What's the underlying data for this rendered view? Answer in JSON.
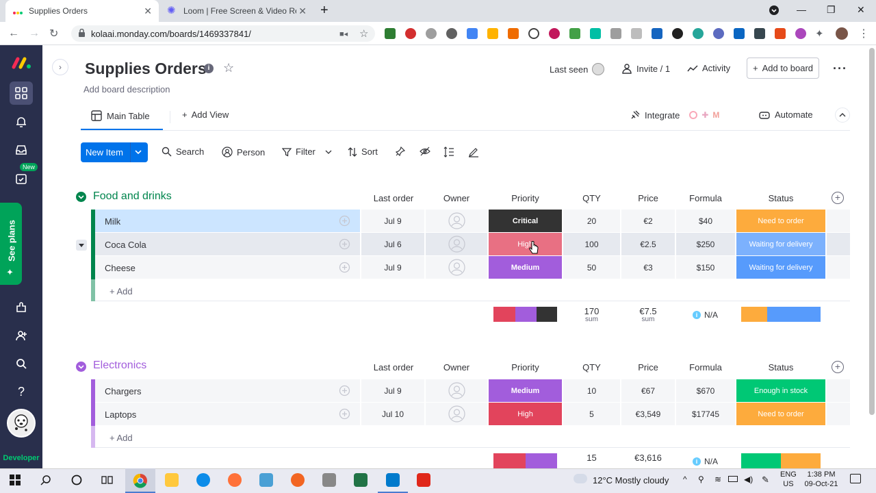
{
  "browser": {
    "tabs": [
      {
        "title": "Supplies Orders"
      },
      {
        "title": "Loom | Free Screen & Video Reco"
      }
    ],
    "url": "kolaai.monday.com/boards/1469337841/"
  },
  "rail": {
    "new_badge": "New",
    "see_plans": "See plans",
    "developer": "Developer"
  },
  "board": {
    "title": "Supplies Orders",
    "description": "Add board description",
    "last_seen": "Last seen",
    "invite": "Invite / 1",
    "activity": "Activity",
    "add_to_board": "Add to board",
    "views": {
      "main_table": "Main Table",
      "add_view": "Add View"
    },
    "integrate": "Integrate",
    "automate": "Automate"
  },
  "toolbar": {
    "new_item": "New Item",
    "search": "Search",
    "person": "Person",
    "filter": "Filter",
    "sort": "Sort"
  },
  "columns": [
    "Last order",
    "Owner",
    "Priority",
    "QTY",
    "Price",
    "Formula",
    "Status"
  ],
  "groups": [
    {
      "name": "Food and drinks",
      "color": "#00854d",
      "rows": [
        {
          "name": "Milk",
          "last_order": "Jul 9",
          "priority": "Critical",
          "priority_color": "#333333",
          "qty": "20",
          "price": "€2",
          "formula": "$40",
          "status": "Need to order",
          "status_color": "#fdab3d"
        },
        {
          "name": "Coca Cola",
          "last_order": "Jul 6",
          "priority": "High",
          "priority_color": "#e2445c",
          "qty": "100",
          "price": "€2.5",
          "formula": "$250",
          "status": "Waiting for delivery",
          "status_color": "#579bfc"
        },
        {
          "name": "Cheese",
          "last_order": "Jul 9",
          "priority": "Medium",
          "priority_color": "#a25ddc",
          "qty": "50",
          "price": "€3",
          "formula": "$150",
          "status": "Waiting for delivery",
          "status_color": "#579bfc"
        }
      ],
      "add": "+ Add",
      "summary": {
        "qty": "170",
        "qty_label": "sum",
        "price": "€7.5",
        "price_label": "sum",
        "formula": "N/A"
      }
    },
    {
      "name": "Electronics",
      "color": "#a25ddc",
      "rows": [
        {
          "name": "Chargers",
          "last_order": "Jul 9",
          "priority": "Medium",
          "priority_color": "#a25ddc",
          "qty": "10",
          "price": "€67",
          "formula": "$670",
          "status": "Enough in stock",
          "status_color": "#00c875"
        },
        {
          "name": "Laptops",
          "last_order": "Jul 10",
          "priority": "High",
          "priority_color": "#e2445c",
          "qty": "5",
          "price": "€3,549",
          "formula": "$17745",
          "status": "Need to order",
          "status_color": "#fdab3d"
        }
      ],
      "add": "+ Add",
      "summary": {
        "qty": "15",
        "price": "€3,616",
        "formula": "N/A"
      }
    }
  ],
  "taskbar": {
    "weather": "12°C  Mostly cloudy",
    "lang": "ENG",
    "region": "US",
    "time": "1:38 PM",
    "date": "09-Oct-21"
  }
}
